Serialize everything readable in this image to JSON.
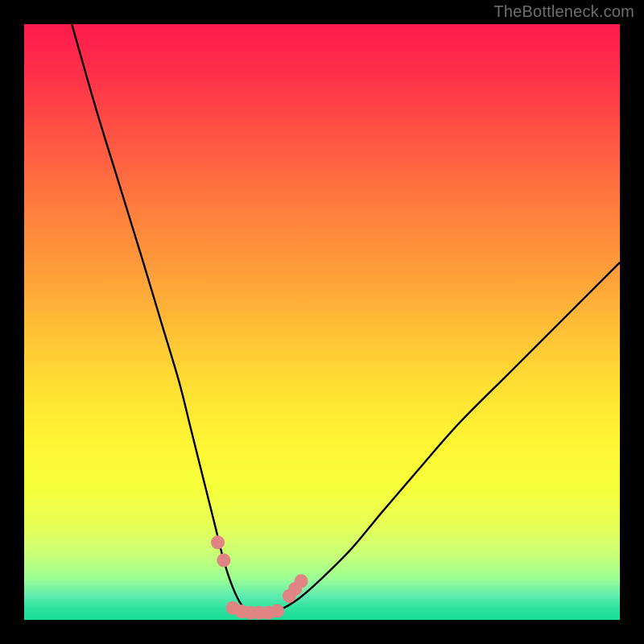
{
  "watermark": "TheBottleneck.com",
  "colors": {
    "frame": "#000000",
    "curve_stroke": "#000000",
    "marker_fill": "#e08484",
    "marker_stroke": "#d06868",
    "gradient_stops": [
      "#ff1a4d",
      "#ff2f4a",
      "#ff5843",
      "#ff7a3e",
      "#ff993a",
      "#ffbb36",
      "#ffdd33",
      "#fff533",
      "#f6ff3a",
      "#e7ff55",
      "#c8ff76",
      "#9dff94",
      "#5eecb0",
      "#2ee3a0",
      "#18dd97"
    ]
  },
  "chart_data": {
    "type": "line",
    "title": "",
    "xlabel": "",
    "ylabel": "",
    "xlim": [
      0,
      100
    ],
    "ylim": [
      0,
      100
    ],
    "series": [
      {
        "name": "bottleneck-curve",
        "x": [
          8,
          12,
          16,
          20,
          23,
          26,
          28,
          30,
          32,
          33.5,
          35,
          36.5,
          38,
          40,
          42.5,
          46,
          50,
          55,
          60,
          66,
          73,
          82,
          92,
          100
        ],
        "y": [
          100,
          86,
          73,
          60,
          50,
          40,
          32,
          24,
          16,
          10,
          5.5,
          2.5,
          1.2,
          1,
          1.5,
          3.5,
          7,
          12,
          18,
          25,
          33,
          42,
          52,
          60
        ]
      }
    ],
    "markers": {
      "name": "highlight-points",
      "x": [
        32.5,
        33.5,
        35.0,
        36.5,
        38.0,
        39.5,
        41.0,
        42.5,
        44.5,
        45.5,
        46.5
      ],
      "y": [
        13.0,
        10.0,
        2.0,
        1.4,
        1.2,
        1.2,
        1.2,
        1.5,
        4.0,
        5.2,
        6.5
      ]
    }
  }
}
